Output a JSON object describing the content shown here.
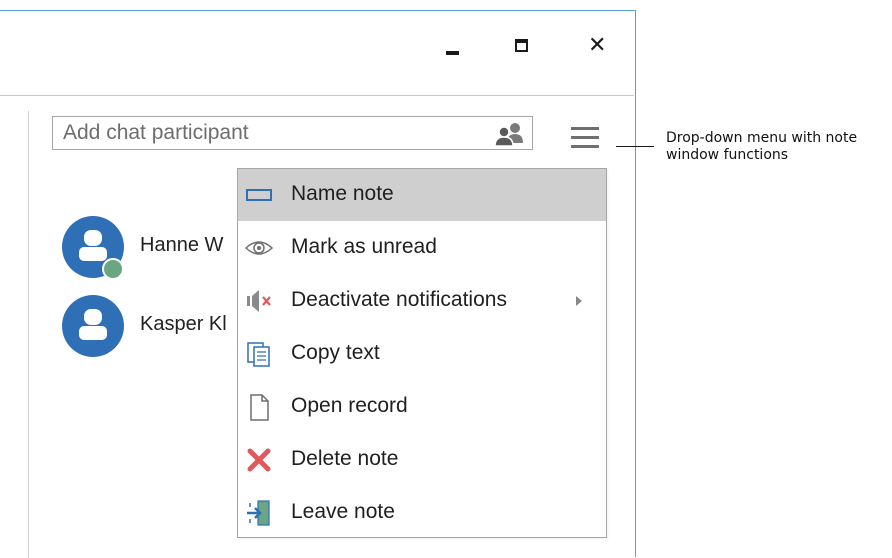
{
  "window": {
    "minimize_icon": "minimize-icon",
    "maximize_icon": "maximize-icon",
    "close_icon": "close-icon",
    "close_glyph": "✕"
  },
  "search": {
    "placeholder": "Add chat participant",
    "icon": "people-icon"
  },
  "menu_button_icon": "hamburger-menu-icon",
  "participants": [
    {
      "name": "Hanne W",
      "online": true
    },
    {
      "name": "Kasper Kl",
      "online": false
    }
  ],
  "menu": {
    "items": [
      {
        "label": "Name note",
        "icon": "rename-icon",
        "highlighted": true
      },
      {
        "label": "Mark as unread",
        "icon": "eye-icon"
      },
      {
        "label": "Deactivate notifications",
        "icon": "mute-speaker-icon",
        "has_submenu": true
      },
      {
        "label": "Copy text",
        "icon": "copy-icon"
      },
      {
        "label": "Open record",
        "icon": "document-icon"
      },
      {
        "label": "Delete note",
        "icon": "delete-x-icon"
      },
      {
        "label": "Leave note",
        "icon": "exit-icon"
      }
    ]
  },
  "callout": {
    "text": "Drop-down menu with note window functions"
  },
  "colors": {
    "window_border": "#5b9bd5",
    "avatar": "#2f6fb5",
    "online": "#6aa684",
    "highlight": "#cfcfcf",
    "delete_red": "#e0585d",
    "mute_red": "#e0585d",
    "icon_blue": "#2f6fb5"
  }
}
